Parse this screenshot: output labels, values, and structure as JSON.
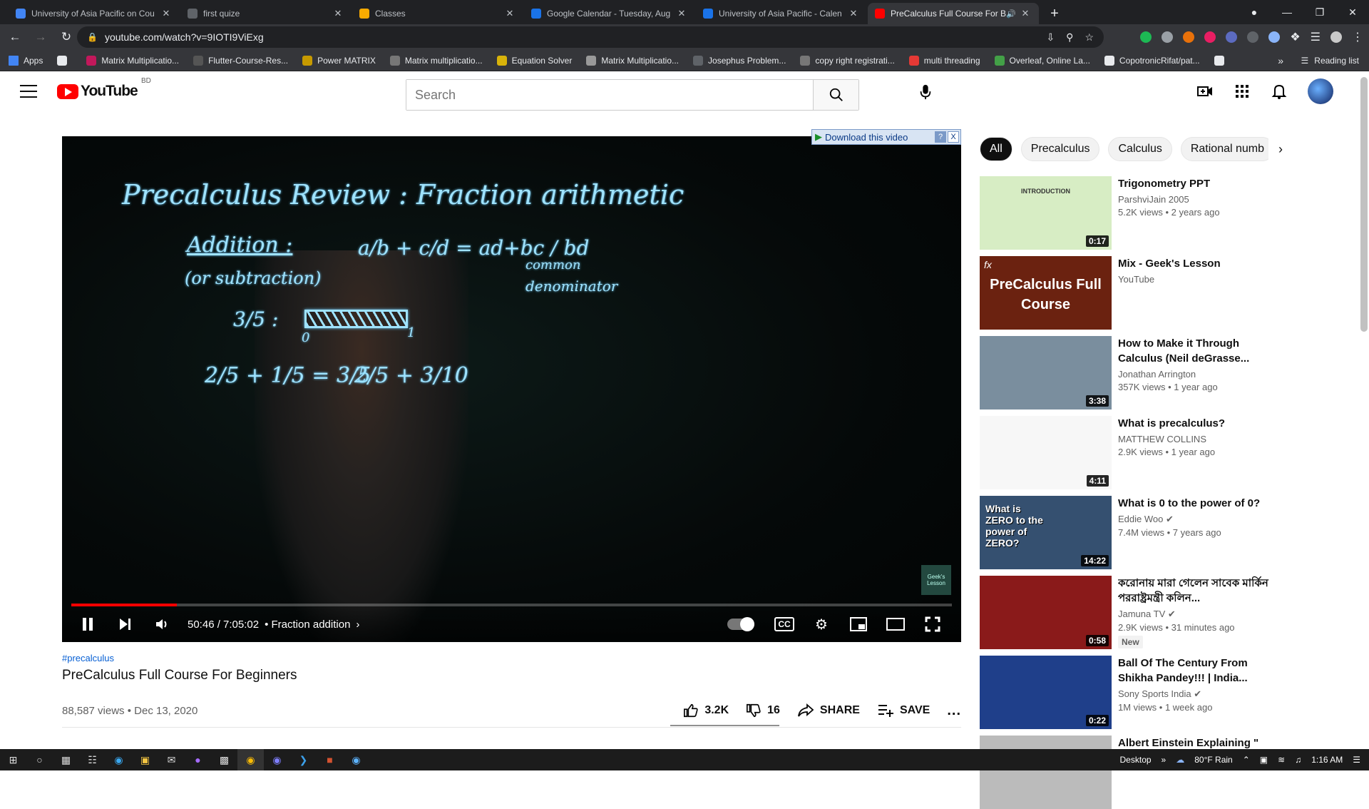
{
  "browser": {
    "tabs": [
      {
        "title": "University of Asia Pacific on Cou",
        "icon": "c-icon",
        "color": "#4285f4",
        "active": false
      },
      {
        "title": "first quize",
        "icon": "classroom-icon",
        "color": "#5f6368",
        "active": false
      },
      {
        "title": "Classes",
        "icon": "classes-icon",
        "color": "#f9ab00",
        "active": false
      },
      {
        "title": "Google Calendar - Tuesday, Aug",
        "icon": "calendar-icon",
        "color": "#1a73e8",
        "active": false
      },
      {
        "title": "University of Asia Pacific - Calen",
        "icon": "calendar-icon",
        "color": "#1a73e8",
        "active": false
      },
      {
        "title": "PreCalculus Full Course For B",
        "icon": "youtube-icon",
        "color": "#ff0000",
        "active": true
      }
    ],
    "address": "youtube.com/watch?v=9IOTI9ViExg",
    "bookmarks": [
      "Apps",
      "",
      "Matrix Multiplicatio...",
      "Flutter-Course-Res...",
      "Power MATRIX",
      "Matrix multiplicatio...",
      "Equation Solver",
      "Matrix Multiplicatio...",
      "Josephus Problem...",
      "copy right registrati...",
      "multi threading",
      "Overleaf, Online La...",
      "CopotronicRifat/pat...",
      ""
    ],
    "reading_list": "Reading list"
  },
  "youtube": {
    "logo_word": "YouTube",
    "country": "BD",
    "search_placeholder": "Search"
  },
  "player": {
    "download_label": "Download this video",
    "download_help": "?",
    "download_close": "X",
    "board_title": "Precalculus Review : Fraction arithmetic",
    "board_addition": "Addition :",
    "board_subtraction": "(or subtraction)",
    "board_formula": "a/b + c/d = ad+bc / bd",
    "board_common": "common",
    "board_denominator": "denominator",
    "board_three_fifths": "3/5 :",
    "board_tick0": "0",
    "board_tick1": "1",
    "board_sum": "2/5 + 1/5 = 3/5",
    "board_sum2": "2/5 + 3/10",
    "watermark": "Geek's Lesson",
    "time_current": "50:46",
    "time_total": "7:05:02",
    "time_text": "50:46 / 7:05:02",
    "chapter": "• Fraction addition",
    "progress": 0.12
  },
  "video": {
    "hashtag": "#precalculus",
    "title": "PreCalculus Full Course For Beginners",
    "meta": "88,587 views • Dec 13, 2020",
    "likes": "3.2K",
    "dislikes": "16",
    "share": "SHARE",
    "save": "SAVE",
    "more": "..."
  },
  "chips": [
    "All",
    "Precalculus",
    "Calculus",
    "Rational numb"
  ],
  "recommendations": [
    {
      "title": "Trigonometry PPT",
      "channel": "ParshviJain 2005",
      "meta": "5.2K views • 2 years ago",
      "duration": "0:17",
      "verified": false,
      "new": "",
      "thumb_color": "#d7edc4",
      "thumb_text": "INTRODUCTION"
    },
    {
      "title": "Mix - Geek's Lesson",
      "channel": "YouTube",
      "meta": "",
      "duration": "",
      "verified": false,
      "new": "",
      "thumb_color": "#6b2210",
      "thumb_text": "PreCalculus Full Course"
    },
    {
      "title": "How to Make it Through Calculus (Neil deGrasse...",
      "channel": "Jonathan Arrington",
      "meta": "357K views • 1 year ago",
      "duration": "3:38",
      "verified": false,
      "new": "",
      "thumb_color": "#7a8e9e",
      "thumb_text": ""
    },
    {
      "title": "What is precalculus?",
      "channel": "MATTHEW COLLINS",
      "meta": "2.9K views • 1 year ago",
      "duration": "4:11",
      "verified": false,
      "new": "",
      "thumb_color": "#f7f7f7",
      "thumb_text": ""
    },
    {
      "title": "What is 0 to the power of 0?",
      "channel": "Eddie Woo",
      "meta": "7.4M views • 7 years ago",
      "duration": "14:22",
      "verified": true,
      "new": "",
      "thumb_color": "#355070",
      "thumb_text": "What is ZERO to the power of ZERO?"
    },
    {
      "title": "করোনায় মারা গেলেন সাবেক মার্কিন পররাষ্ট্রমন্ত্রী কলিন...",
      "channel": "Jamuna TV",
      "meta": "2.9K views • 31 minutes ago",
      "duration": "0:58",
      "verified": true,
      "new": "New",
      "thumb_color": "#8a1a1a",
      "thumb_text": ""
    },
    {
      "title": "Ball Of The Century From Shikha Pandey!!! | India...",
      "channel": "Sony Sports India",
      "meta": "1M views • 1 week ago",
      "duration": "0:22",
      "verified": true,
      "new": "",
      "thumb_color": "#1f3f8a",
      "thumb_text": ""
    },
    {
      "title": "Albert Einstein Explaining \"",
      "channel": "",
      "meta": "",
      "duration": "",
      "verified": false,
      "new": "",
      "thumb_color": "#bbbbbb",
      "thumb_text": ""
    }
  ],
  "taskbar": {
    "desktop": "Desktop",
    "weather": "80°F Rain",
    "time": "1:16 AM"
  }
}
